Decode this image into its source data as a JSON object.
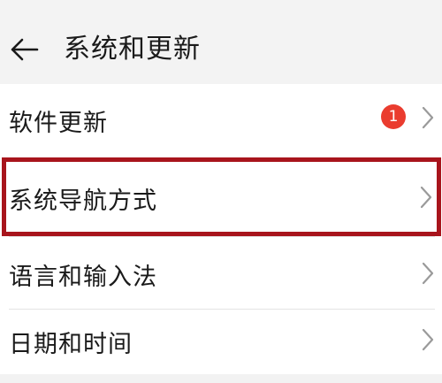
{
  "header": {
    "title": "系统和更新",
    "back_icon": "arrow-left-icon"
  },
  "items": [
    {
      "label": "软件更新",
      "badge": "1",
      "chevron_icon": "chevron-right-icon"
    },
    {
      "label": "系统导航方式",
      "chevron_icon": "chevron-right-icon",
      "highlighted": true
    },
    {
      "label": "语言和输入法",
      "chevron_icon": "chevron-right-icon"
    },
    {
      "label": "日期和时间",
      "chevron_icon": "chevron-right-icon"
    }
  ],
  "colors": {
    "badge": "#ea3c2f",
    "highlight_border": "#a8141c",
    "background": "#f2f2f2",
    "list_background": "#ffffff"
  }
}
